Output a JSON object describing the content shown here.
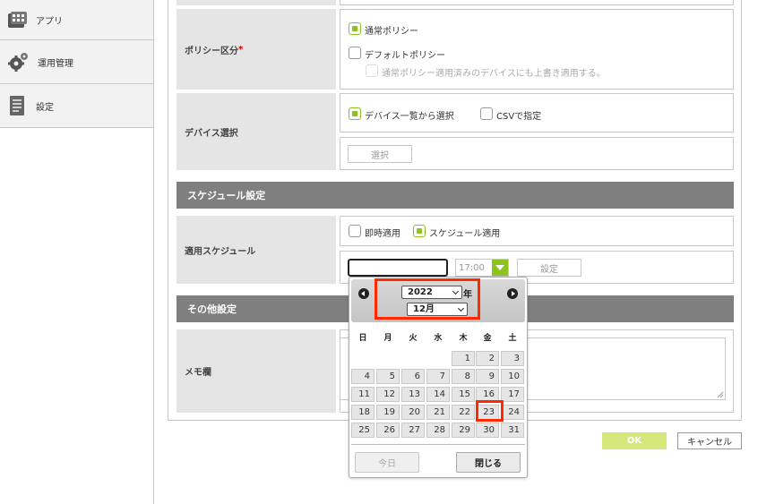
{
  "sidebar": {
    "items": [
      {
        "label": "アプリ",
        "icon": "apps-icon"
      },
      {
        "label": "運用管理",
        "icon": "gear-icon"
      },
      {
        "label": "設定",
        "icon": "document-icon"
      }
    ]
  },
  "form": {
    "policy_type_label": "ポリシー区分",
    "required_mark": "*",
    "policy_normal": "通常ポリシー",
    "policy_default": "デフォルトポリシー",
    "policy_overwrite": "通常ポリシー適用済みのデバイスにも上書き適用する。",
    "device_select_label": "デバイス選択",
    "device_from_list": "デバイス一覧から選択",
    "device_csv": "CSVで指定",
    "select_button": "選択",
    "schedule_section": "スケジュール設定",
    "apply_schedule_label": "適用スケジュール",
    "apply_immediate": "即時適用",
    "apply_scheduled": "スケジュール適用",
    "time_value": "17:00",
    "set_button": "設定",
    "other_section": "その他設定",
    "memo_label": "メモ欄",
    "date_value": ""
  },
  "actions": {
    "ok": "OK",
    "cancel": "キャンセル"
  },
  "datepicker": {
    "year": "2022",
    "year_suffix": "年",
    "month": "12月",
    "weekdays": [
      "日",
      "月",
      "火",
      "水",
      "木",
      "金",
      "土"
    ],
    "days": [
      [
        "",
        "",
        "",
        "",
        "1",
        "2",
        "3"
      ],
      [
        "4",
        "5",
        "6",
        "7",
        "8",
        "9",
        "10"
      ],
      [
        "11",
        "12",
        "13",
        "14",
        "15",
        "16",
        "17"
      ],
      [
        "18",
        "19",
        "20",
        "21",
        "22",
        "23",
        "24"
      ],
      [
        "25",
        "26",
        "27",
        "28",
        "29",
        "30",
        "31"
      ]
    ],
    "highlighted_day": "23",
    "today_button": "今日",
    "close_button": "閉じる"
  },
  "colors": {
    "accent": "#8dc21f",
    "highlight": "#ff2a00",
    "section": "#7f7f7f"
  }
}
